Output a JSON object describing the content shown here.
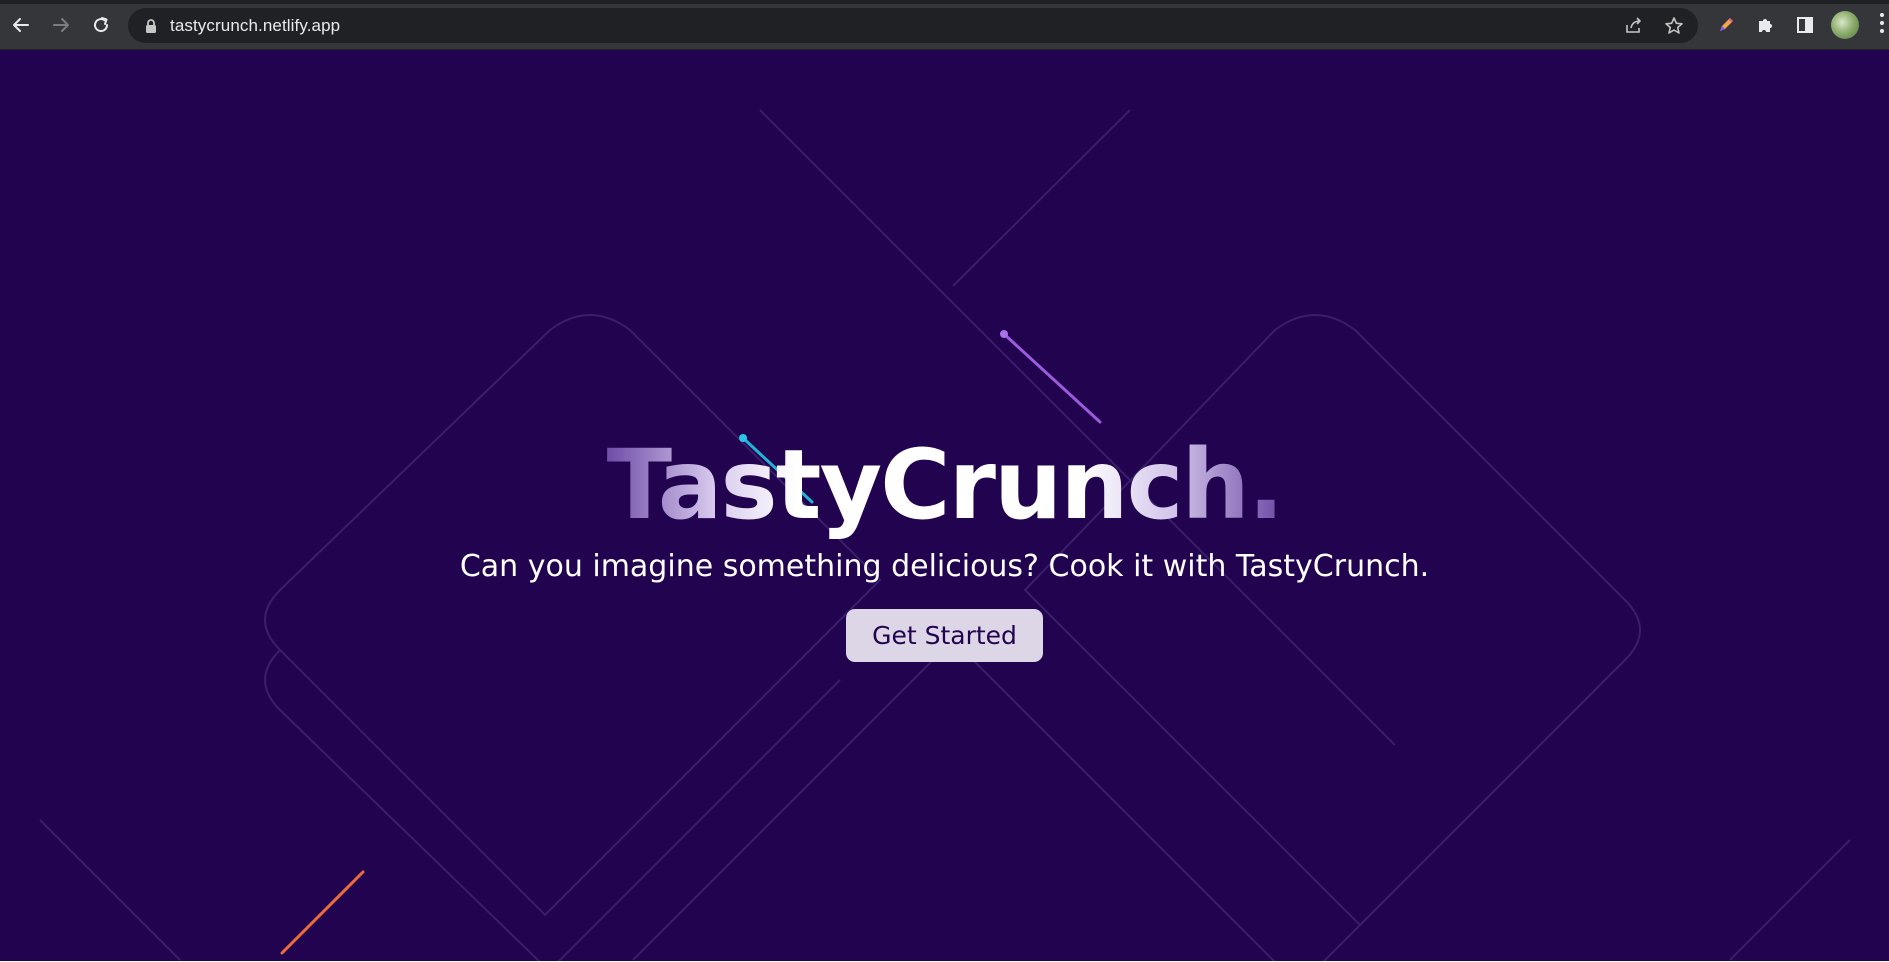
{
  "browser": {
    "url": "tastycrunch.netlify.app",
    "icons": {
      "back": "arrow-left-icon",
      "forward": "arrow-right-icon",
      "reload": "reload-icon",
      "lock": "lock-icon",
      "share": "share-icon",
      "bookmark": "star-icon",
      "extension_pen": "pen-icon",
      "extensions": "puzzle-icon",
      "side_panel": "side-panel-icon",
      "profile": "avatar",
      "menu": "kebab-menu-icon"
    }
  },
  "hero": {
    "title": "TastyCrunch.",
    "subtitle": "Can you imagine something delicious? Cook it with TastyCrunch.",
    "cta_label": "Get Started"
  },
  "colors": {
    "page_background": "#22034f",
    "button_background": "#dcd6e6",
    "button_text": "#22034f",
    "accent_cyan": "#1fb4d6",
    "accent_purple": "#9b5bdc",
    "accent_orange": "#ee6b3b"
  }
}
